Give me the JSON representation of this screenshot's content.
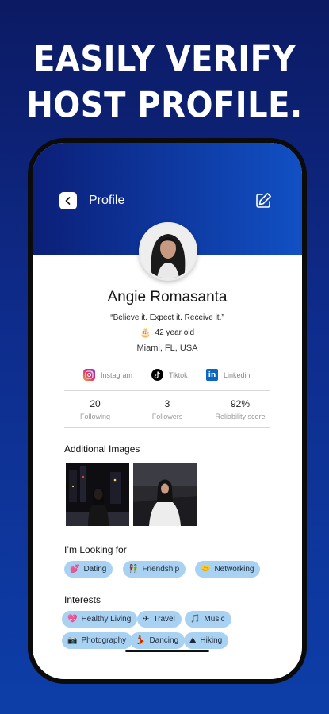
{
  "headline": {
    "line1": "EASILY VERIFY",
    "line2": "HOST PROFILE."
  },
  "header": {
    "title": "Profile",
    "back_icon": "chevron-left-icon",
    "edit_icon": "edit-icon"
  },
  "profile": {
    "name": "Angie Romasanta",
    "quote": "“Believe it. Expect it. Receive it.”",
    "age_icon": "🎂",
    "age": "42 year old",
    "location": "Miami, FL, USA"
  },
  "socials": [
    {
      "label": "Instagram",
      "icon": "instagram-icon",
      "color": "#d62976"
    },
    {
      "label": "Tiktok",
      "icon": "tiktok-icon",
      "color": "#000000"
    },
    {
      "label": "Linkedin",
      "icon": "linkedin-icon",
      "color": "#0a66c2"
    }
  ],
  "stats": [
    {
      "value": "20",
      "label": "Following"
    },
    {
      "value": "3",
      "label": "Followers"
    },
    {
      "value": "92%",
      "label": "Reliability score"
    }
  ],
  "additional_images": {
    "title": "Additional Images"
  },
  "looking_for": {
    "title": "I’m Looking for",
    "items": [
      {
        "emoji": "💕",
        "label": "Dating"
      },
      {
        "emoji": "👫",
        "label": "Friendship"
      },
      {
        "emoji": "🤝",
        "label": "Networking"
      }
    ]
  },
  "interests": {
    "title": "Interests",
    "items": [
      {
        "emoji": "💖",
        "label": "Healthy Living"
      },
      {
        "emoji": "✈",
        "label": "Travel"
      },
      {
        "emoji": "🎵",
        "label": "Music"
      },
      {
        "emoji": "📷",
        "label": "Photography"
      },
      {
        "emoji": "💃",
        "label": "Dancing"
      },
      {
        "emoji": "⛰",
        "label": "Hiking"
      }
    ]
  },
  "colors": {
    "chip": "#a9d2f2",
    "header_start": "#0b1f78",
    "header_end": "#1150c4"
  }
}
